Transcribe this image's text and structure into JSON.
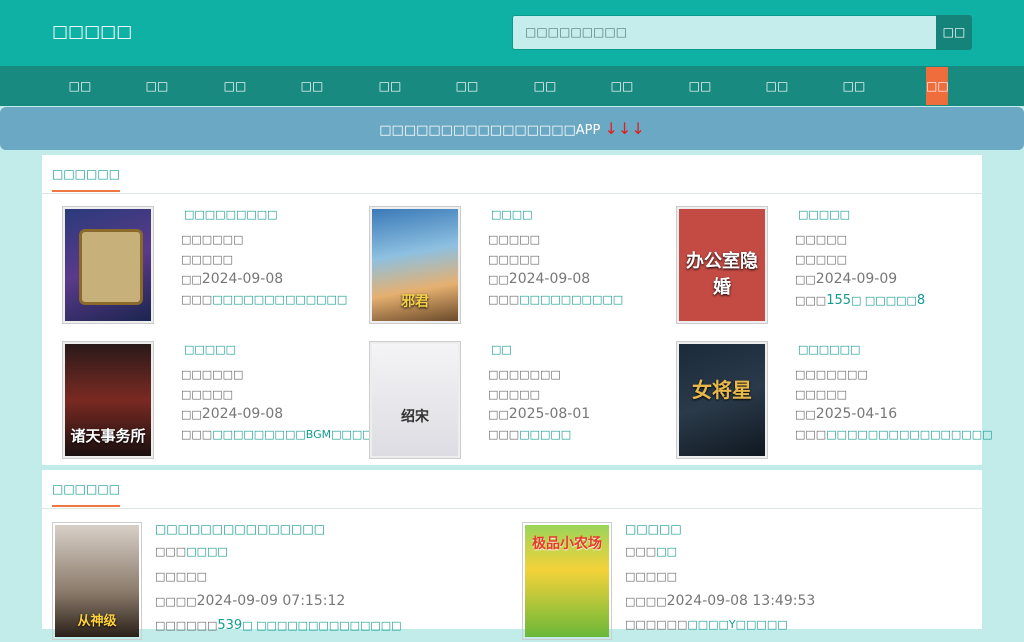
{
  "header": {
    "logo": "□□□□□",
    "search_placeholder": "□□□□□□□□□",
    "search_button": "□□"
  },
  "nav": {
    "items": [
      "□□",
      "□□",
      "□□",
      "□□",
      "□□",
      "□□",
      "□□",
      "□□",
      "□□",
      "□□",
      "□□",
      "□□"
    ]
  },
  "banner": {
    "text": "□□□□□□□□□□□□□□□□APP",
    "arrows": "↓↓↓"
  },
  "hot": {
    "title": "□□□□□□",
    "books": [
      {
        "title": "□□□□□□□□□",
        "author": "□□□□□□",
        "category": "□□□□□",
        "date_prefix": "□□",
        "date": "2024-09-08",
        "latest_prefix": "□□□",
        "latest": "□□□□□□□□□□□□□"
      },
      {
        "title": "□□□□",
        "author": "□□□□□",
        "category": "□□□□□",
        "date_prefix": "□□",
        "date": "2024-09-08",
        "latest_prefix": "□□□",
        "latest": "□□□□□□□□□□"
      },
      {
        "title": "□□□□□",
        "author": "□□□□□",
        "category": "□□□□□",
        "date_prefix": "□□",
        "date": "2024-09-09",
        "latest_prefix": "□□□",
        "latest_num1": "155",
        "latest_mid": "□ □□□□□",
        "latest_num2": "8"
      },
      {
        "title": "□□□□□",
        "author": "□□□□□□",
        "category": "□□□□□",
        "date_prefix": "□□",
        "date": "2024-09-08",
        "latest_prefix": "□□□",
        "latest": "□□□□□□□□□BGM□□□□"
      },
      {
        "title": "□□",
        "author": "□□□□□□□",
        "category": "□□□□□",
        "date_prefix": "□□",
        "date": "2025-08-01",
        "latest_prefix": "□□□",
        "latest": "□□□□□"
      },
      {
        "title": "□□□□□□",
        "author": "□□□□□□□",
        "category": "□□□□□",
        "date_prefix": "□□",
        "date": "2025-04-16",
        "latest_prefix": "□□□",
        "latest": "□□□□□□□□□□□□□□□□"
      }
    ]
  },
  "recent": {
    "title": "□□□□□□",
    "books": [
      {
        "title": "□□□□□□□□□□□□□□□",
        "author_prefix": "□□□",
        "author": "□□□□",
        "category": "□□□□□",
        "update_prefix": "□□□□",
        "update": "2024-09-09 07:15:12",
        "latest_prefix": "□□□□□□",
        "latest_num": "539",
        "latest": "□ □□□□□□□□□□□□□□"
      },
      {
        "title": "□□□□□",
        "author_prefix": "□□□",
        "author": "□□",
        "category": "□□□□□",
        "update_prefix": "□□□□",
        "update": "2024-09-08 13:49:53",
        "latest_prefix": "□□□□□□",
        "latest": "□□□□Y□□□□□"
      }
    ]
  },
  "colors": {
    "header_bg": "#0eb1a3",
    "nav_bg": "#188a80",
    "accent": "#139b8f",
    "active_nav": "#ef6c3c",
    "banner_bg": "#6ba8c4",
    "page_bg": "#c2ecea"
  }
}
